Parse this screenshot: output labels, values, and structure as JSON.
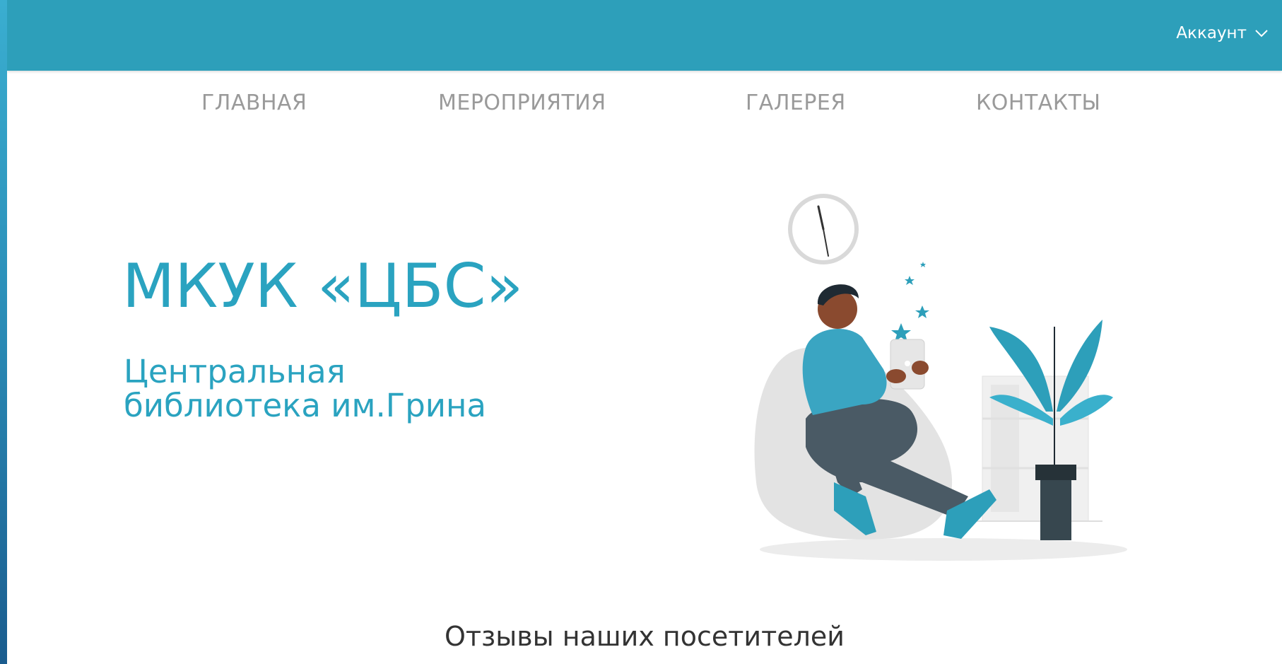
{
  "header": {
    "account_label": "Аккаунт",
    "account_icon": "chevron-down-icon"
  },
  "nav": {
    "items": [
      {
        "label": "ГЛАВНАЯ"
      },
      {
        "label": "МЕРОПРИЯТИЯ"
      },
      {
        "label": "ГАЛЕРЕЯ"
      },
      {
        "label": "КОНТАКТЫ"
      }
    ]
  },
  "hero": {
    "title": "МКУК «ЦБС»",
    "subtitle_line1": "Центральная",
    "subtitle_line2": "библиотека им.Грина"
  },
  "reviews": {
    "heading": "Отзывы наших посетителей"
  },
  "colors": {
    "brand": "#2d9fba",
    "accent_text": "#2aa3c0",
    "nav_text": "#9a9a9a"
  }
}
